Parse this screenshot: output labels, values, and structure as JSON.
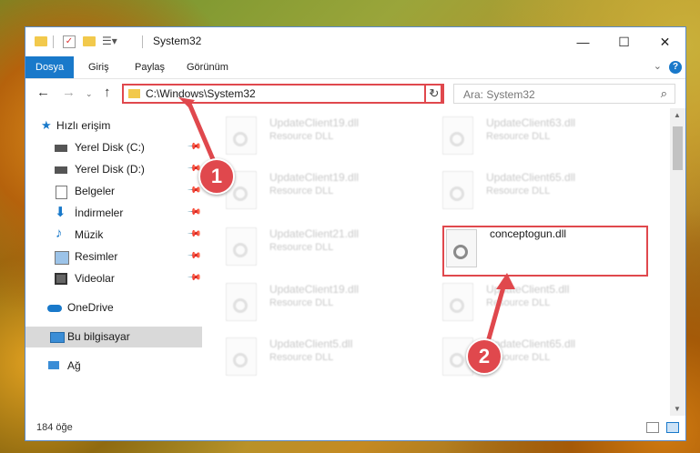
{
  "window": {
    "title": "System32",
    "controls": {
      "minimize": "—",
      "maximize": "☐",
      "close": "✕"
    }
  },
  "ribbon": {
    "tabs": [
      "Dosya",
      "Giriş",
      "Paylaş",
      "Görünüm"
    ],
    "help": "?"
  },
  "nav": {
    "address": "C:\\Windows\\System32",
    "search_placeholder": "Ara: System32"
  },
  "sidebar": {
    "items": [
      {
        "label": "Hızlı erişim",
        "icon": "star-icon"
      },
      {
        "label": "Yerel Disk (C:)",
        "icon": "drive-icon"
      },
      {
        "label": "Yerel Disk (D:)",
        "icon": "drive-icon"
      },
      {
        "label": "Belgeler",
        "icon": "documents-icon"
      },
      {
        "label": "İndirmeler",
        "icon": "download-icon"
      },
      {
        "label": "Müzik",
        "icon": "music-icon"
      },
      {
        "label": "Resimler",
        "icon": "pictures-icon"
      },
      {
        "label": "Videolar",
        "icon": "video-icon"
      },
      {
        "label": "OneDrive",
        "icon": "cloud-icon"
      },
      {
        "label": "Bu bilgisayar",
        "icon": "computer-icon"
      },
      {
        "label": "Ağ",
        "icon": "network-icon"
      }
    ]
  },
  "files": {
    "left": [
      {
        "name": "UpdateClient19.dll",
        "type": "Resource DLL"
      },
      {
        "name": "UpdateClient19.dll",
        "type": "Resource DLL"
      },
      {
        "name": "UpdateClient21.dll",
        "type": "Resource DLL"
      },
      {
        "name": "UpdateClient19.dll",
        "type": "Resource DLL"
      },
      {
        "name": "UpdateClient5.dll",
        "type": "Resource DLL"
      }
    ],
    "right": [
      {
        "name": "UpdateClient63.dll",
        "type": "Resource DLL"
      },
      {
        "name": "UpdateClient65.dll",
        "type": "Resource DLL"
      },
      {
        "name": "conceptogun.dll",
        "type": ""
      },
      {
        "name": "UpdateClient5.dll",
        "type": "Resource DLL"
      },
      {
        "name": "UpdateClient65.dll",
        "type": "Resource DLL"
      }
    ]
  },
  "status": {
    "count": "184 öğe"
  },
  "callouts": {
    "one": "1",
    "two": "2"
  },
  "colors": {
    "accent": "#1979ca",
    "highlight": "#e0484d"
  }
}
